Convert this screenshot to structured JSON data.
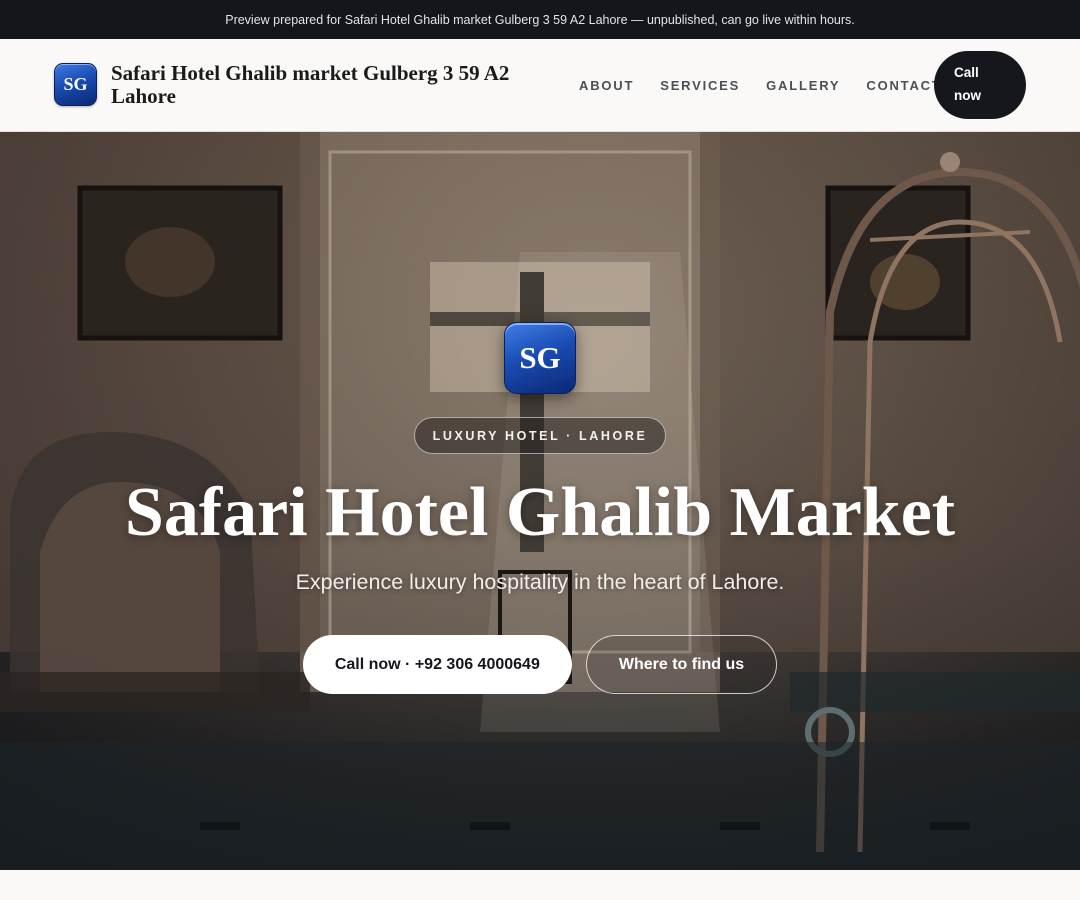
{
  "preview_bar": {
    "text": "Preview prepared for Safari Hotel Ghalib market Gulberg 3 59 A2 Lahore — unpublished, can go live within hours."
  },
  "header": {
    "logo_initials": "SG",
    "brand_name": "Safari Hotel Ghalib market Gulberg 3 59 A2 Lahore",
    "nav": [
      {
        "label": "ABOUT"
      },
      {
        "label": "SERVICES"
      },
      {
        "label": "GALLERY"
      },
      {
        "label": "CONTACT"
      }
    ],
    "call_button": "Call now"
  },
  "hero": {
    "logo_initials": "SG",
    "badge": "LUXURY HOTEL · LAHORE",
    "title": "Safari Hotel Ghalib Market",
    "subtitle": "Experience luxury hospitality in the heart of Lahore.",
    "primary_button": "Call now · +92 306 4000649",
    "secondary_button": "Where to find us"
  },
  "colors": {
    "preview_bar_bg": "#13161b",
    "header_bg": "#faf9f7",
    "accent_dark": "#15171c",
    "logo_blue": "#1a4cb3"
  }
}
